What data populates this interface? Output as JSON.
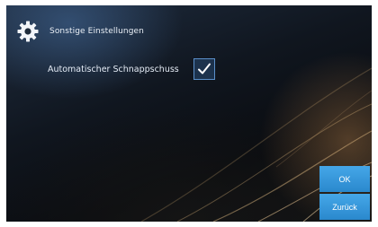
{
  "header": {
    "title": "Sonstige Einstellungen",
    "icon": "gear-icon"
  },
  "settings": {
    "items": [
      {
        "label": "Automatischer Schnappschuss",
        "checked": true
      }
    ]
  },
  "buttons": {
    "ok_label": "OK",
    "back_label": "Zurück"
  },
  "colors": {
    "accent": "#3a9ee0",
    "checkbox_border": "#5a8fca",
    "text": "#e6edf7"
  }
}
